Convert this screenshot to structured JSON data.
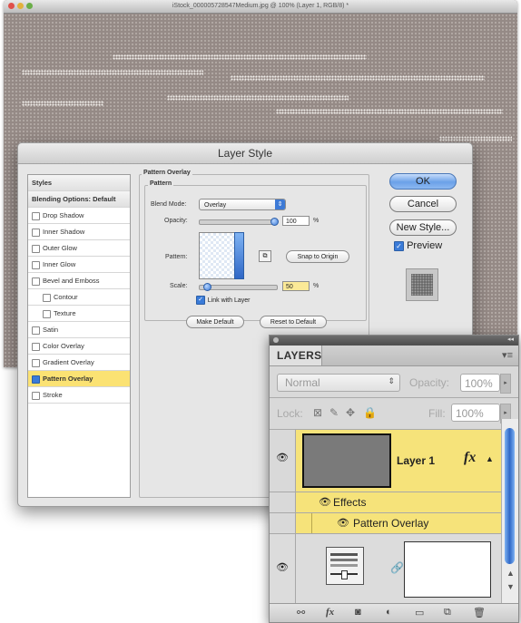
{
  "document": {
    "title": "iStock_000005728547Medium.jpg @ 100% (Layer 1, RGB/8) *"
  },
  "dialog": {
    "title": "Layer Style",
    "styles_header": "Styles",
    "blending_options": "Blending Options: Default",
    "effects": [
      {
        "label": "Drop Shadow",
        "checked": false,
        "indent": false
      },
      {
        "label": "Inner Shadow",
        "checked": false,
        "indent": false
      },
      {
        "label": "Outer Glow",
        "checked": false,
        "indent": false
      },
      {
        "label": "Inner Glow",
        "checked": false,
        "indent": false
      },
      {
        "label": "Bevel and Emboss",
        "checked": false,
        "indent": false
      },
      {
        "label": "Contour",
        "checked": false,
        "indent": true
      },
      {
        "label": "Texture",
        "checked": false,
        "indent": true
      },
      {
        "label": "Satin",
        "checked": false,
        "indent": false
      },
      {
        "label": "Color Overlay",
        "checked": false,
        "indent": false
      },
      {
        "label": "Gradient Overlay",
        "checked": false,
        "indent": false
      },
      {
        "label": "Pattern Overlay",
        "checked": true,
        "indent": false,
        "selected": true
      },
      {
        "label": "Stroke",
        "checked": false,
        "indent": false
      }
    ],
    "pattern_overlay_group": "Pattern Overlay",
    "pattern_group": "Pattern",
    "blend_mode_label": "Blend Mode:",
    "blend_mode_value": "Overlay",
    "opacity_label": "Opacity:",
    "opacity_value": "100",
    "opacity_unit": "%",
    "opacity_level": 1.0,
    "pattern_label": "Pattern:",
    "snap_to_origin": "Snap to Origin",
    "scale_label": "Scale:",
    "scale_value": "50",
    "scale_unit": "%",
    "scale_level": 0.05,
    "link_with_layer": "Link with Layer",
    "link_checked": true,
    "make_default": "Make Default",
    "reset_to_default": "Reset to Default",
    "ok": "OK",
    "cancel": "Cancel",
    "new_style": "New Style...",
    "preview": "Preview",
    "preview_checked": true
  },
  "layers_panel": {
    "tab": "LAYERS",
    "blend_mode": "Normal",
    "opacity_label": "Opacity:",
    "opacity_value": "100%",
    "lock_label": "Lock:",
    "fill_label": "Fill:",
    "fill_value": "100%",
    "layer1_name": "Layer 1",
    "fx_badge": "fx",
    "effects_label": "Effects",
    "pattern_overlay_label": "Pattern Overlay",
    "accent": "#f6e37a"
  }
}
